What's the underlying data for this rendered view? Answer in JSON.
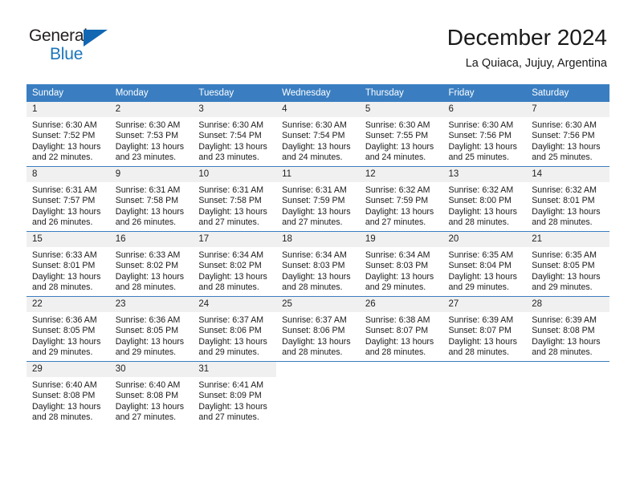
{
  "logo": {
    "text_top": "General",
    "text_bottom": "Blue",
    "accent_color": "#1b75bb"
  },
  "header": {
    "title": "December 2024",
    "subtitle": "La Quiaca, Jujuy, Argentina",
    "header_bg": "#3a7ec1"
  },
  "weekdays": [
    "Sunday",
    "Monday",
    "Tuesday",
    "Wednesday",
    "Thursday",
    "Friday",
    "Saturday"
  ],
  "weeks": [
    [
      {
        "day": "1",
        "sunrise": "Sunrise: 6:30 AM",
        "sunset": "Sunset: 7:52 PM",
        "daylight1": "Daylight: 13 hours",
        "daylight2": "and 22 minutes."
      },
      {
        "day": "2",
        "sunrise": "Sunrise: 6:30 AM",
        "sunset": "Sunset: 7:53 PM",
        "daylight1": "Daylight: 13 hours",
        "daylight2": "and 23 minutes."
      },
      {
        "day": "3",
        "sunrise": "Sunrise: 6:30 AM",
        "sunset": "Sunset: 7:54 PM",
        "daylight1": "Daylight: 13 hours",
        "daylight2": "and 23 minutes."
      },
      {
        "day": "4",
        "sunrise": "Sunrise: 6:30 AM",
        "sunset": "Sunset: 7:54 PM",
        "daylight1": "Daylight: 13 hours",
        "daylight2": "and 24 minutes."
      },
      {
        "day": "5",
        "sunrise": "Sunrise: 6:30 AM",
        "sunset": "Sunset: 7:55 PM",
        "daylight1": "Daylight: 13 hours",
        "daylight2": "and 24 minutes."
      },
      {
        "day": "6",
        "sunrise": "Sunrise: 6:30 AM",
        "sunset": "Sunset: 7:56 PM",
        "daylight1": "Daylight: 13 hours",
        "daylight2": "and 25 minutes."
      },
      {
        "day": "7",
        "sunrise": "Sunrise: 6:30 AM",
        "sunset": "Sunset: 7:56 PM",
        "daylight1": "Daylight: 13 hours",
        "daylight2": "and 25 minutes."
      }
    ],
    [
      {
        "day": "8",
        "sunrise": "Sunrise: 6:31 AM",
        "sunset": "Sunset: 7:57 PM",
        "daylight1": "Daylight: 13 hours",
        "daylight2": "and 26 minutes."
      },
      {
        "day": "9",
        "sunrise": "Sunrise: 6:31 AM",
        "sunset": "Sunset: 7:58 PM",
        "daylight1": "Daylight: 13 hours",
        "daylight2": "and 26 minutes."
      },
      {
        "day": "10",
        "sunrise": "Sunrise: 6:31 AM",
        "sunset": "Sunset: 7:58 PM",
        "daylight1": "Daylight: 13 hours",
        "daylight2": "and 27 minutes."
      },
      {
        "day": "11",
        "sunrise": "Sunrise: 6:31 AM",
        "sunset": "Sunset: 7:59 PM",
        "daylight1": "Daylight: 13 hours",
        "daylight2": "and 27 minutes."
      },
      {
        "day": "12",
        "sunrise": "Sunrise: 6:32 AM",
        "sunset": "Sunset: 7:59 PM",
        "daylight1": "Daylight: 13 hours",
        "daylight2": "and 27 minutes."
      },
      {
        "day": "13",
        "sunrise": "Sunrise: 6:32 AM",
        "sunset": "Sunset: 8:00 PM",
        "daylight1": "Daylight: 13 hours",
        "daylight2": "and 28 minutes."
      },
      {
        "day": "14",
        "sunrise": "Sunrise: 6:32 AM",
        "sunset": "Sunset: 8:01 PM",
        "daylight1": "Daylight: 13 hours",
        "daylight2": "and 28 minutes."
      }
    ],
    [
      {
        "day": "15",
        "sunrise": "Sunrise: 6:33 AM",
        "sunset": "Sunset: 8:01 PM",
        "daylight1": "Daylight: 13 hours",
        "daylight2": "and 28 minutes."
      },
      {
        "day": "16",
        "sunrise": "Sunrise: 6:33 AM",
        "sunset": "Sunset: 8:02 PM",
        "daylight1": "Daylight: 13 hours",
        "daylight2": "and 28 minutes."
      },
      {
        "day": "17",
        "sunrise": "Sunrise: 6:34 AM",
        "sunset": "Sunset: 8:02 PM",
        "daylight1": "Daylight: 13 hours",
        "daylight2": "and 28 minutes."
      },
      {
        "day": "18",
        "sunrise": "Sunrise: 6:34 AM",
        "sunset": "Sunset: 8:03 PM",
        "daylight1": "Daylight: 13 hours",
        "daylight2": "and 28 minutes."
      },
      {
        "day": "19",
        "sunrise": "Sunrise: 6:34 AM",
        "sunset": "Sunset: 8:03 PM",
        "daylight1": "Daylight: 13 hours",
        "daylight2": "and 29 minutes."
      },
      {
        "day": "20",
        "sunrise": "Sunrise: 6:35 AM",
        "sunset": "Sunset: 8:04 PM",
        "daylight1": "Daylight: 13 hours",
        "daylight2": "and 29 minutes."
      },
      {
        "day": "21",
        "sunrise": "Sunrise: 6:35 AM",
        "sunset": "Sunset: 8:05 PM",
        "daylight1": "Daylight: 13 hours",
        "daylight2": "and 29 minutes."
      }
    ],
    [
      {
        "day": "22",
        "sunrise": "Sunrise: 6:36 AM",
        "sunset": "Sunset: 8:05 PM",
        "daylight1": "Daylight: 13 hours",
        "daylight2": "and 29 minutes."
      },
      {
        "day": "23",
        "sunrise": "Sunrise: 6:36 AM",
        "sunset": "Sunset: 8:05 PM",
        "daylight1": "Daylight: 13 hours",
        "daylight2": "and 29 minutes."
      },
      {
        "day": "24",
        "sunrise": "Sunrise: 6:37 AM",
        "sunset": "Sunset: 8:06 PM",
        "daylight1": "Daylight: 13 hours",
        "daylight2": "and 29 minutes."
      },
      {
        "day": "25",
        "sunrise": "Sunrise: 6:37 AM",
        "sunset": "Sunset: 8:06 PM",
        "daylight1": "Daylight: 13 hours",
        "daylight2": "and 28 minutes."
      },
      {
        "day": "26",
        "sunrise": "Sunrise: 6:38 AM",
        "sunset": "Sunset: 8:07 PM",
        "daylight1": "Daylight: 13 hours",
        "daylight2": "and 28 minutes."
      },
      {
        "day": "27",
        "sunrise": "Sunrise: 6:39 AM",
        "sunset": "Sunset: 8:07 PM",
        "daylight1": "Daylight: 13 hours",
        "daylight2": "and 28 minutes."
      },
      {
        "day": "28",
        "sunrise": "Sunrise: 6:39 AM",
        "sunset": "Sunset: 8:08 PM",
        "daylight1": "Daylight: 13 hours",
        "daylight2": "and 28 minutes."
      }
    ],
    [
      {
        "day": "29",
        "sunrise": "Sunrise: 6:40 AM",
        "sunset": "Sunset: 8:08 PM",
        "daylight1": "Daylight: 13 hours",
        "daylight2": "and 28 minutes."
      },
      {
        "day": "30",
        "sunrise": "Sunrise: 6:40 AM",
        "sunset": "Sunset: 8:08 PM",
        "daylight1": "Daylight: 13 hours",
        "daylight2": "and 27 minutes."
      },
      {
        "day": "31",
        "sunrise": "Sunrise: 6:41 AM",
        "sunset": "Sunset: 8:09 PM",
        "daylight1": "Daylight: 13 hours",
        "daylight2": "and 27 minutes."
      },
      {
        "day": "",
        "sunrise": "",
        "sunset": "",
        "daylight1": "",
        "daylight2": ""
      },
      {
        "day": "",
        "sunrise": "",
        "sunset": "",
        "daylight1": "",
        "daylight2": ""
      },
      {
        "day": "",
        "sunrise": "",
        "sunset": "",
        "daylight1": "",
        "daylight2": ""
      },
      {
        "day": "",
        "sunrise": "",
        "sunset": "",
        "daylight1": "",
        "daylight2": ""
      }
    ]
  ]
}
